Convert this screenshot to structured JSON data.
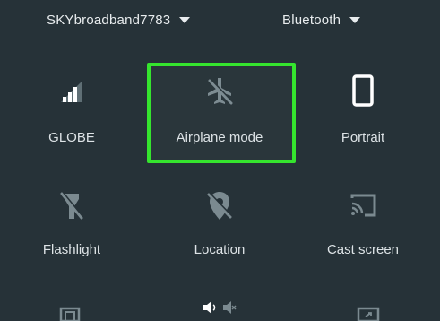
{
  "topbar": {
    "network_label": "SKYbroadband7783",
    "bluetooth_label": "Bluetooth"
  },
  "tiles": [
    {
      "label": "GLOBE",
      "icon": "signal-bars-icon"
    },
    {
      "label": "Airplane mode",
      "icon": "airplane-icon",
      "highlighted": true
    },
    {
      "label": "Portrait",
      "icon": "phone-portrait-icon"
    },
    {
      "label": "Flashlight",
      "icon": "flashlight-off-icon"
    },
    {
      "label": "Location",
      "icon": "location-off-icon"
    },
    {
      "label": "Cast screen",
      "icon": "cast-icon"
    }
  ],
  "colors": {
    "background": "#263238",
    "highlight": "#35e52e",
    "icon_active": "#ffffff",
    "icon_dim": "#7b8a90"
  }
}
